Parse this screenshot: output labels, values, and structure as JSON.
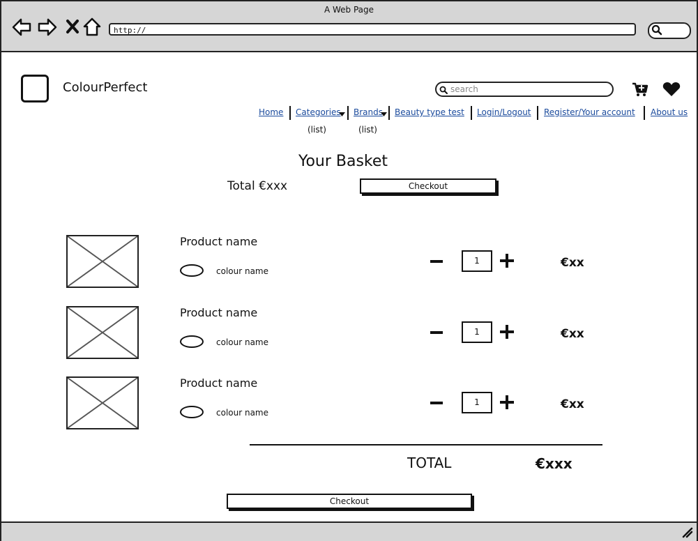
{
  "browser": {
    "title": "A Web Page",
    "url": "http://"
  },
  "site": {
    "brand": "ColourPerfect",
    "search_placeholder": "search"
  },
  "nav": {
    "items": [
      {
        "label": "Home"
      },
      {
        "label": "Categories",
        "sub": "(list)"
      },
      {
        "label": "Brands",
        "sub": "(list)"
      },
      {
        "label": "Beauty type test"
      },
      {
        "label": "Login/Logout"
      },
      {
        "label": "Register/Your account"
      },
      {
        "label": "About us"
      }
    ]
  },
  "basket": {
    "title": "Your Basket",
    "total_top": "Total €xxx",
    "checkout_label": "Checkout",
    "items": [
      {
        "name": "Product name",
        "colour": "colour name",
        "qty": "1",
        "price": "€xx"
      },
      {
        "name": "Product name",
        "colour": "colour name",
        "qty": "1",
        "price": "€xx"
      },
      {
        "name": "Product name",
        "colour": "colour name",
        "qty": "1",
        "price": "€xx"
      }
    ],
    "total_label": "TOTAL",
    "total_value": "€xxx"
  }
}
